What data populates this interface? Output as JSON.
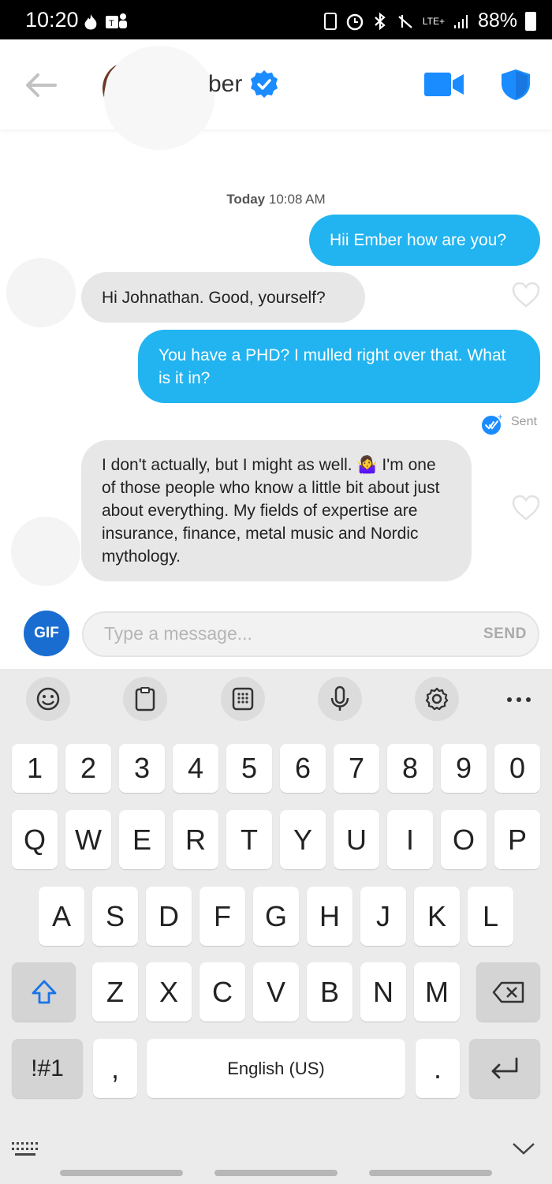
{
  "status_bar": {
    "time": "10:20",
    "network": "LTE+",
    "battery": "88%"
  },
  "header": {
    "name_fragment": "ber",
    "colors": {
      "accent": "#1a8cff",
      "verified": "#1a8cff"
    }
  },
  "chat": {
    "date_label": "Today",
    "time_label": "10:08 AM",
    "messages": [
      {
        "side": "out",
        "text": "Hii Ember how are you?"
      },
      {
        "side": "in",
        "text": "Hi Johnathan. Good, yourself?"
      },
      {
        "side": "out",
        "text": "You have a PHD? I mulled right over that. What is it in?"
      },
      {
        "side": "in",
        "text": "I don't actually, but I might as well. 🤷‍♀️ I'm one of those people who know a little bit about just about everything. My fields of expertise are insurance, finance, metal music and Nordic mythology."
      }
    ],
    "sent_label": "Sent",
    "colors": {
      "outgoing": "#21b4f0",
      "incoming": "#e7e7e7"
    }
  },
  "composer": {
    "gif_label": "GIF",
    "placeholder": "Type a message...",
    "send_label": "SEND"
  },
  "keyboard": {
    "toolbar": [
      "emoji-icon",
      "clipboard-icon",
      "keypad-icon",
      "microphone-icon",
      "settings-icon",
      "more-icon"
    ],
    "number_row": [
      "1",
      "2",
      "3",
      "4",
      "5",
      "6",
      "7",
      "8",
      "9",
      "0"
    ],
    "row1": [
      "Q",
      "W",
      "E",
      "R",
      "T",
      "Y",
      "U",
      "I",
      "O",
      "P"
    ],
    "row2": [
      "A",
      "S",
      "D",
      "F",
      "G",
      "H",
      "J",
      "K",
      "L"
    ],
    "row3": [
      "Z",
      "X",
      "C",
      "V",
      "B",
      "N",
      "M"
    ],
    "symbols_label": "!#1",
    "comma": ",",
    "space_label": "English (US)",
    "period": "."
  }
}
